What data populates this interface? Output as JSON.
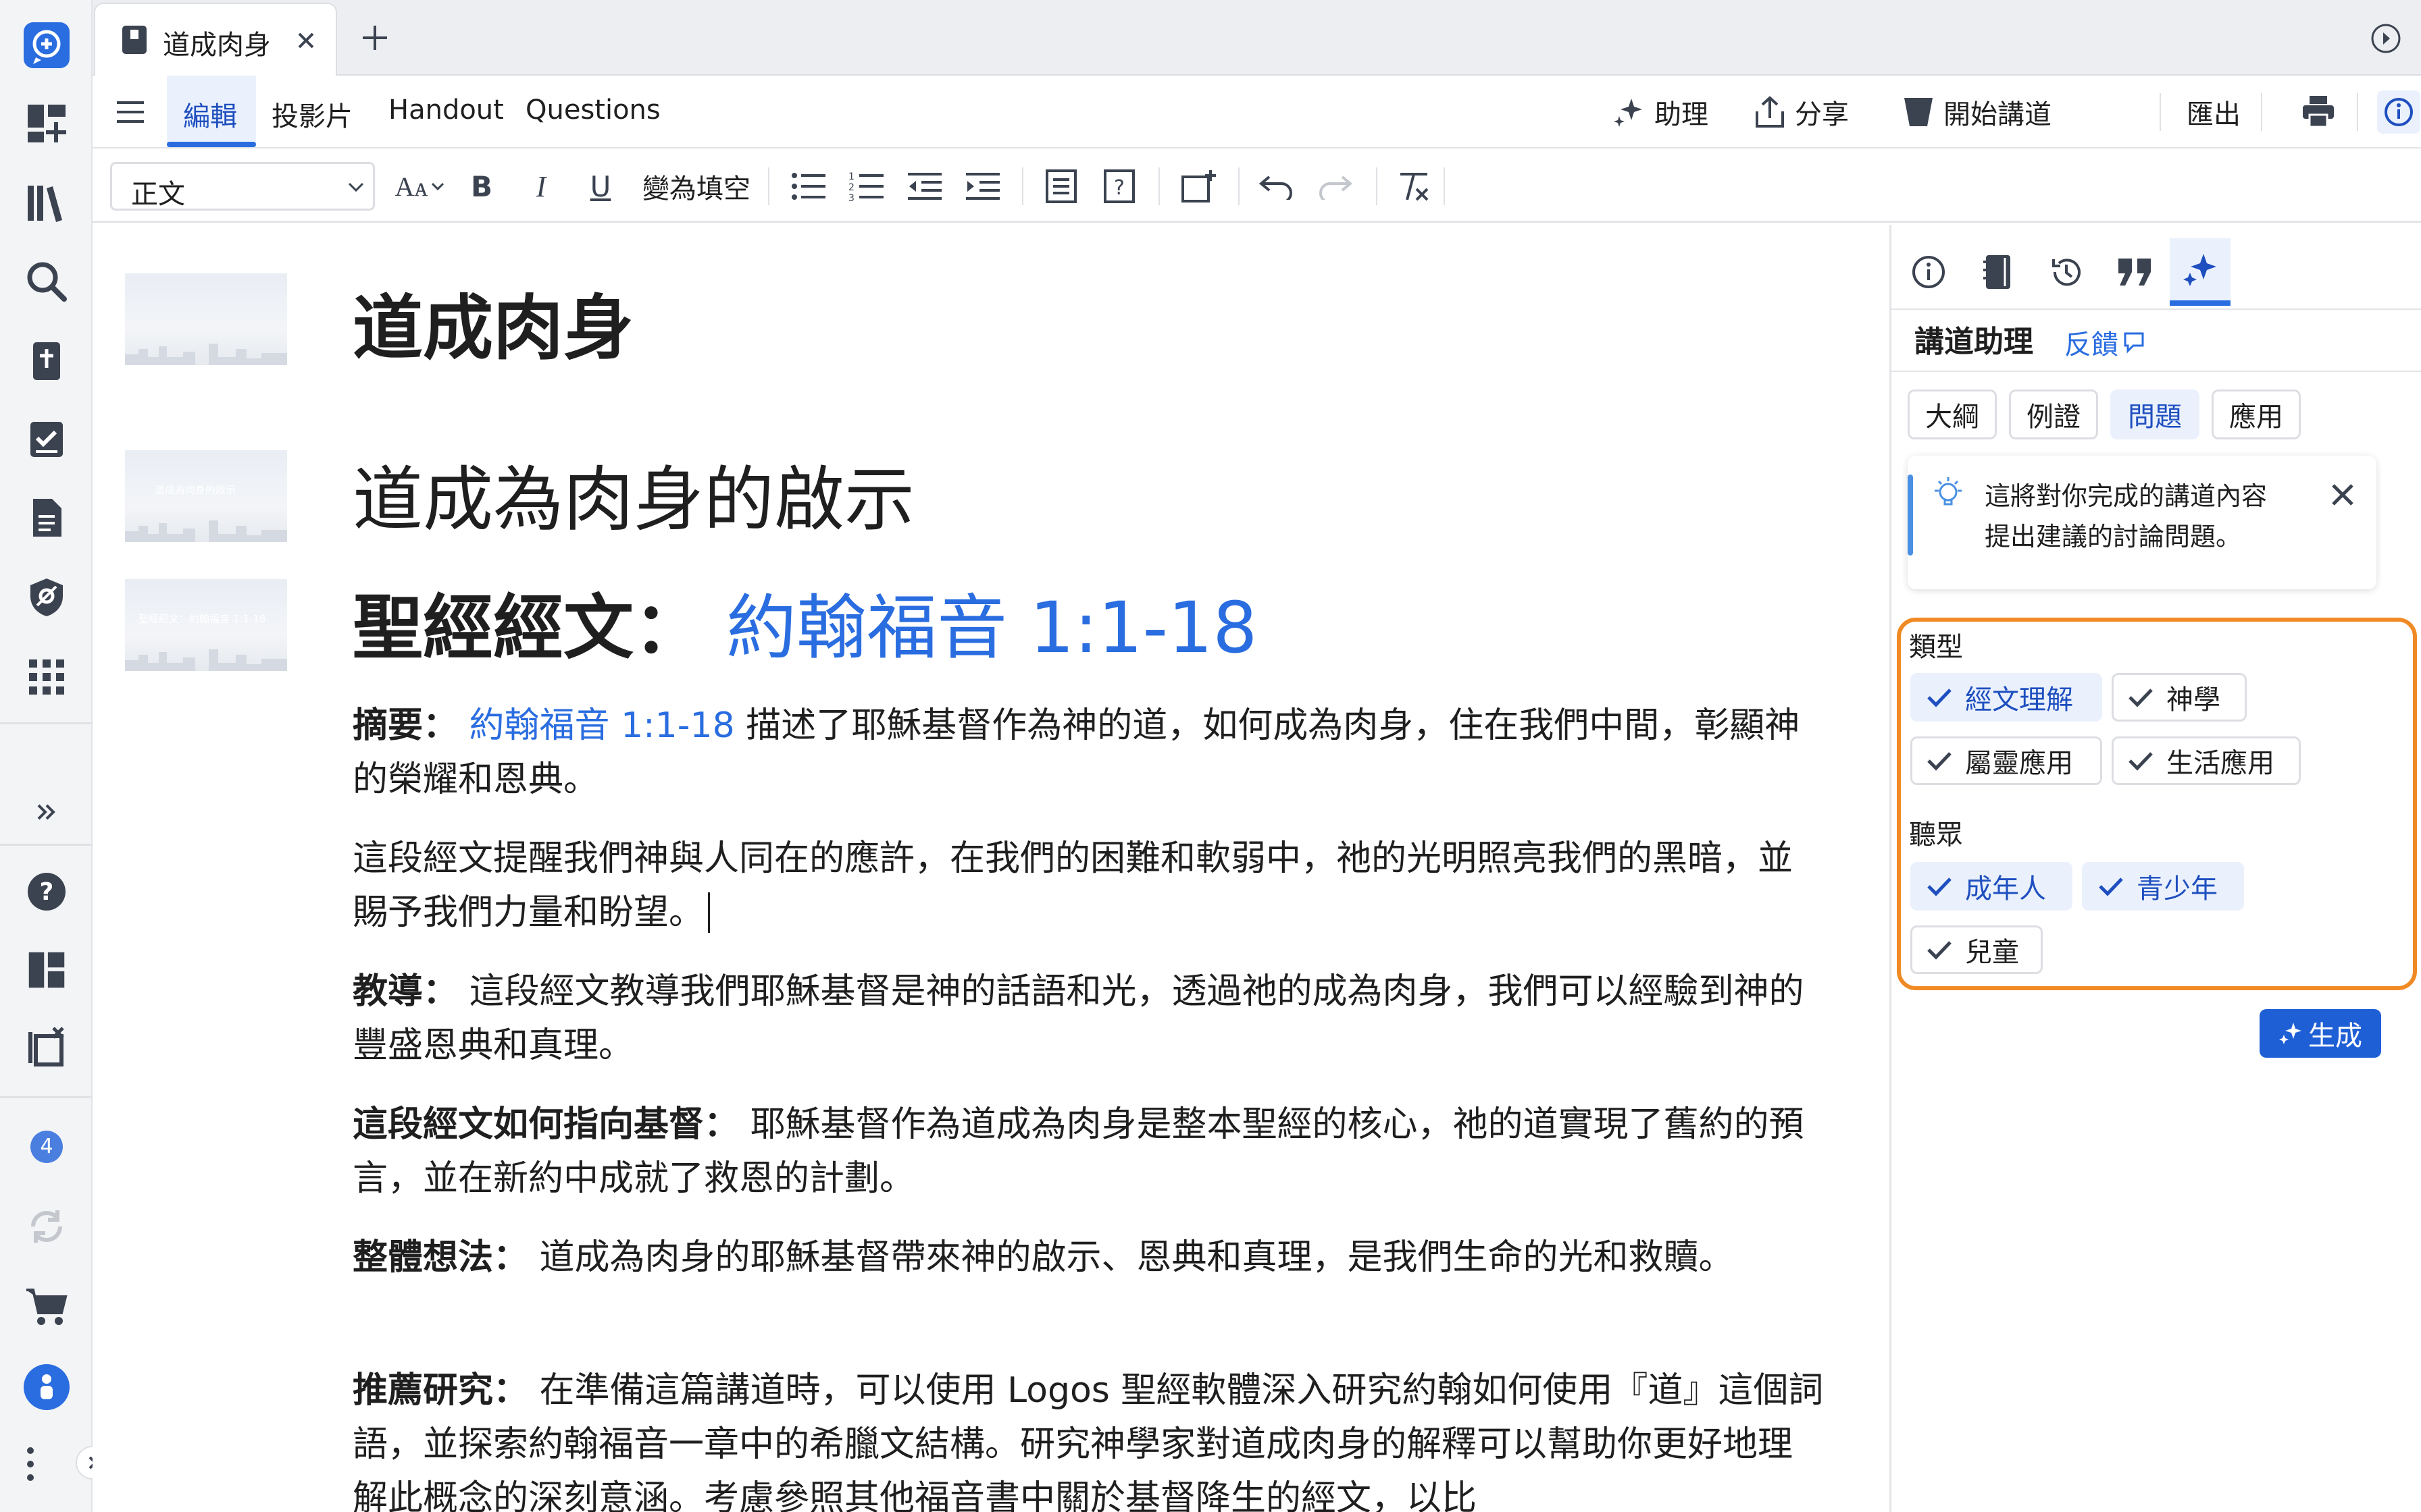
{
  "tab": {
    "title": "道成肉身"
  },
  "menu": {
    "tabs": [
      "編輯",
      "投影片",
      "Handout",
      "Questions"
    ],
    "assistant": "助理",
    "share": "分享",
    "start_preach": "開始講道",
    "export": "匯出"
  },
  "toolbar": {
    "style_value": "正文",
    "cloze_label": "變為填空"
  },
  "document": {
    "title": "道成肉身",
    "heading": "道成為肉身的啟示",
    "scripture_label": "聖經經文：",
    "scripture_ref": "約翰福音 1:1-18",
    "thumb2_text": "道成為肉身的啟示",
    "thumb3_text": "聖經經文：約翰福音 1:1-18",
    "paragraphs": {
      "summary_label": "摘要：",
      "summary_link": "約翰福音 1:1-18",
      "summary_text": "描述了耶穌基督作為神的道，如何成為肉身，住在我們中間，彰顯神的榮耀和恩典。",
      "p2": "這段經文提醒我們神與人同在的應許，在我們的困難和軟弱中，祂的光明照亮我們的黑暗，並賜予我們力量和盼望。",
      "teaching_label": "教導：",
      "teaching_text": "這段經文教導我們耶穌基督是神的話語和光，透過祂的成為肉身，我們可以經驗到神的豐盛恩典和真理。",
      "christ_label": "這段經文如何指向基督：",
      "christ_text": "耶穌基督作為道成為肉身是整本聖經的核心，祂的道實現了舊約的預言，並在新約中成就了救恩的計劃。",
      "idea_label": "整體想法：",
      "idea_text": "道成為肉身的耶穌基督帶來神的啟示、恩典和真理，是我們生命的光和救贖。",
      "study_label": "推薦研究：",
      "study_text": "在準備這篇講道時，可以使用 Logos 聖經軟體深入研究約翰如何使用『道』這個詞語，並探索約翰福音一章中的希臘文結構。研究神學家對道成肉身的解釋可以幫助你更好地理解此概念的深刻意涵。考慮參照其他福音書中關於基督降生的經文，以比"
    }
  },
  "sidebar": {
    "badge_count": "4"
  },
  "panel": {
    "title": "講道助理",
    "feedback": "反饋",
    "chips": [
      "大綱",
      "例證",
      "問題",
      "應用"
    ],
    "selected_chip": "問題",
    "info_text_line1": "這將對你完成的講道內容",
    "info_text_line2": "提出建議的討論問題。",
    "type_label": "類型",
    "type_options": [
      {
        "label": "經文理解",
        "selected": true
      },
      {
        "label": "神學",
        "selected": false
      },
      {
        "label": "屬靈應用",
        "selected": false
      },
      {
        "label": "生活應用",
        "selected": false
      }
    ],
    "audience_label": "聽眾",
    "audience_options": [
      {
        "label": "成年人",
        "selected": true
      },
      {
        "label": "青少年",
        "selected": true
      },
      {
        "label": "兒童",
        "selected": false
      }
    ],
    "generate_label": "生成"
  },
  "colors": {
    "accent": "#2a6de0",
    "highlight_border": "#f08a24",
    "generate_bg": "#1f5fd6"
  }
}
